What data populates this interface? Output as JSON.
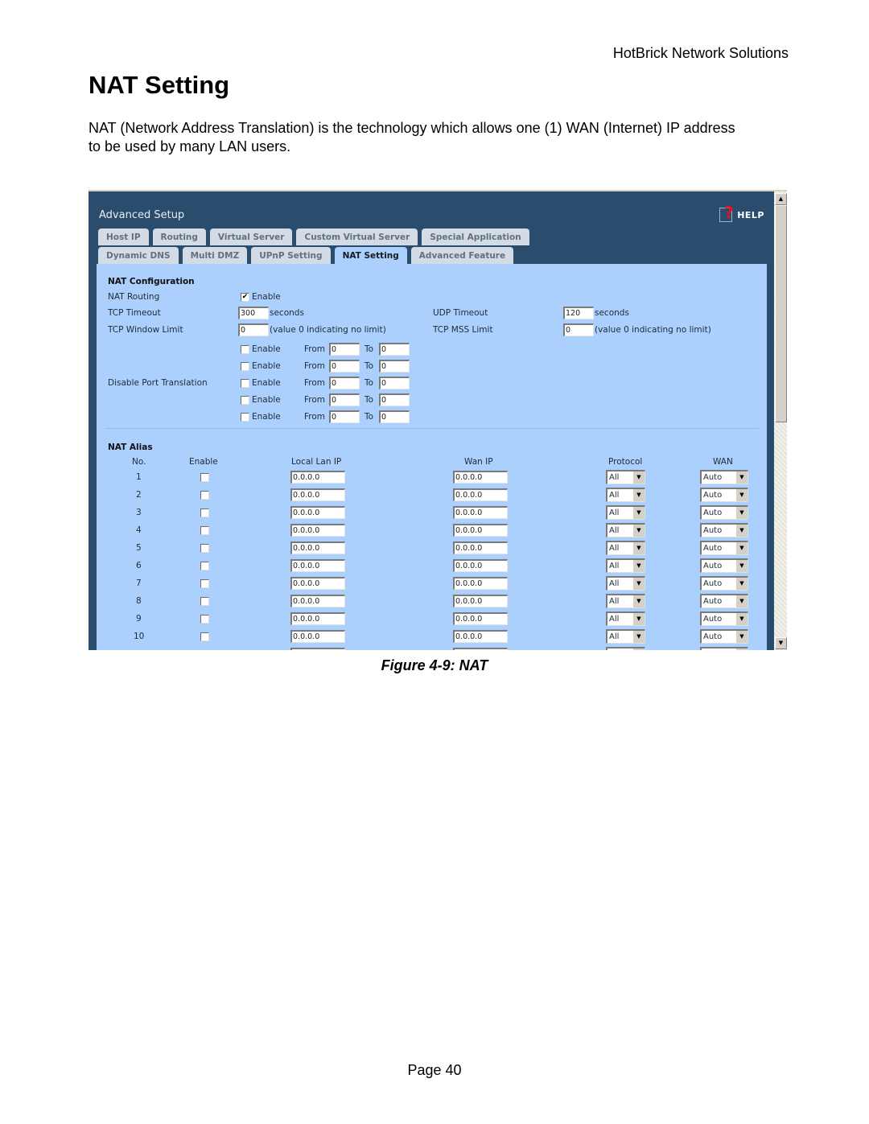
{
  "document": {
    "company": "HotBrick Network Solutions",
    "title": "NAT Setting",
    "intro": "NAT (Network Address Translation) is the technology which allows one (1) WAN (Internet) IP address to be used by many LAN users.",
    "caption": "Figure 4-9: NAT",
    "page": "Page 40"
  },
  "screenshot": {
    "app_title": "Advanced Setup",
    "help_label": "HELP",
    "tabs_row1": [
      "Host IP",
      "Routing",
      "Virtual Server",
      "Custom Virtual Server",
      "Special Application"
    ],
    "tabs_row2": [
      "Dynamic DNS",
      "Multi DMZ",
      "UPnP Setting",
      "NAT Setting",
      "Advanced Feature"
    ],
    "active_tab": "NAT Setting",
    "nat_config": {
      "section_title": "NAT Configuration",
      "nat_routing_label": "NAT Routing",
      "nat_routing_enable_label": "Enable",
      "nat_routing_checked": true,
      "tcp_timeout_label": "TCP Timeout",
      "tcp_timeout_value": "300",
      "seconds_label": "seconds",
      "udp_timeout_label": "UDP Timeout",
      "udp_timeout_value": "120",
      "tcp_window_label": "TCP Window Limit",
      "tcp_window_value": "0",
      "no_limit_note": "(value 0 indicating no limit)",
      "tcp_mss_label": "TCP MSS Limit",
      "tcp_mss_value": "0",
      "port_translation_label": "Disable Port Translation",
      "enable_label": "Enable",
      "from_label": "From",
      "to_label": "To",
      "port_rows": [
        {
          "enabled": false,
          "from": "0",
          "to": "0"
        },
        {
          "enabled": false,
          "from": "0",
          "to": "0"
        },
        {
          "enabled": false,
          "from": "0",
          "to": "0"
        },
        {
          "enabled": false,
          "from": "0",
          "to": "0"
        },
        {
          "enabled": false,
          "from": "0",
          "to": "0"
        }
      ]
    },
    "nat_alias": {
      "section_title": "NAT Alias",
      "columns": [
        "No.",
        "Enable",
        "Local Lan IP",
        "Wan IP",
        "Protocol",
        "WAN"
      ],
      "rows": [
        {
          "no": "1",
          "enabled": false,
          "local_ip": "0.0.0.0",
          "wan_ip": "0.0.0.0",
          "protocol": "All",
          "wan": "Auto"
        },
        {
          "no": "2",
          "enabled": false,
          "local_ip": "0.0.0.0",
          "wan_ip": "0.0.0.0",
          "protocol": "All",
          "wan": "Auto"
        },
        {
          "no": "3",
          "enabled": false,
          "local_ip": "0.0.0.0",
          "wan_ip": "0.0.0.0",
          "protocol": "All",
          "wan": "Auto"
        },
        {
          "no": "4",
          "enabled": false,
          "local_ip": "0.0.0.0",
          "wan_ip": "0.0.0.0",
          "protocol": "All",
          "wan": "Auto"
        },
        {
          "no": "5",
          "enabled": false,
          "local_ip": "0.0.0.0",
          "wan_ip": "0.0.0.0",
          "protocol": "All",
          "wan": "Auto"
        },
        {
          "no": "6",
          "enabled": false,
          "local_ip": "0.0.0.0",
          "wan_ip": "0.0.0.0",
          "protocol": "All",
          "wan": "Auto"
        },
        {
          "no": "7",
          "enabled": false,
          "local_ip": "0.0.0.0",
          "wan_ip": "0.0.0.0",
          "protocol": "All",
          "wan": "Auto"
        },
        {
          "no": "8",
          "enabled": false,
          "local_ip": "0.0.0.0",
          "wan_ip": "0.0.0.0",
          "protocol": "All",
          "wan": "Auto"
        },
        {
          "no": "9",
          "enabled": false,
          "local_ip": "0.0.0.0",
          "wan_ip": "0.0.0.0",
          "protocol": "All",
          "wan": "Auto"
        },
        {
          "no": "10",
          "enabled": false,
          "local_ip": "0.0.0.0",
          "wan_ip": "0.0.0.0",
          "protocol": "All",
          "wan": "Auto"
        },
        {
          "no": "",
          "enabled": false,
          "local_ip": "",
          "wan_ip": "",
          "protocol": "",
          "wan": ""
        }
      ]
    },
    "icons": {
      "help": "help-question-icon",
      "dropdown_arrow": "▼",
      "scroll_up": "▲",
      "scroll_down": "▼",
      "check": "✔"
    }
  }
}
